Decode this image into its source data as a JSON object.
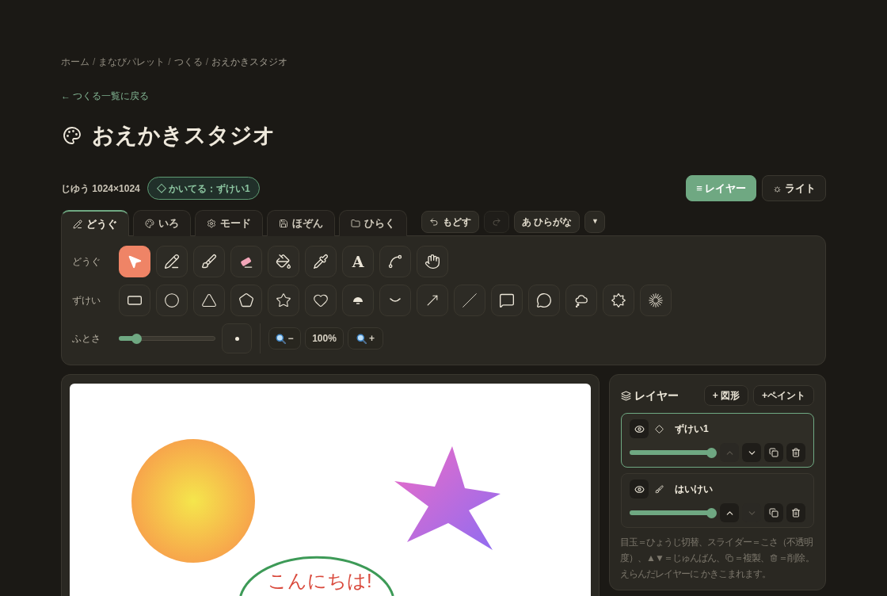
{
  "breadcrumb": [
    {
      "kind": "link",
      "text": "ホーム"
    },
    {
      "kind": "separator",
      "text": "/"
    },
    {
      "kind": "link",
      "text": "まなびパレット"
    },
    {
      "kind": "separator",
      "text": "/"
    },
    {
      "kind": "link",
      "text": "つくる"
    },
    {
      "kind": "separator",
      "text": "/"
    },
    {
      "kind": "current",
      "text": "おえかきスタジオ"
    }
  ],
  "back_link": "← つくる一覧に戻る",
  "title": "おえかきスタジオ",
  "canvas_info": "じゆう 1024×1024",
  "status_pill": "◇ かいてる：ずけい1",
  "header_buttons": [
    {
      "label": "≡ レイヤー",
      "on": true
    },
    {
      "label": "☼ ライト",
      "on": false
    }
  ],
  "tabs": [
    {
      "label": "どうぐ",
      "selected": true
    },
    {
      "label": "いろ",
      "selected": false
    },
    {
      "label": "モード",
      "selected": false
    },
    {
      "label": "ほぞん",
      "selected": false
    },
    {
      "label": "ひらく",
      "selected": false
    }
  ],
  "history": [
    {
      "kind": "undo",
      "label": "もどす",
      "disabled": false
    },
    {
      "kind": "redo",
      "disabled": true
    }
  ],
  "input_mode": {
    "label": "あ ひらがな",
    "menu": "▼"
  },
  "tools": {
    "label": "どうぐ",
    "items": [
      {
        "selected": true
      },
      {
        "selected": false
      },
      {
        "selected": false
      },
      {
        "selected": false
      },
      {
        "selected": false
      },
      {
        "selected": false
      },
      {
        "selected": false,
        "glyph": "A"
      },
      {
        "selected": false
      },
      {
        "selected": false
      }
    ]
  },
  "shapes": {
    "label": "ずけい",
    "items": [
      {
        "selected": false
      },
      {
        "selected": false
      },
      {
        "selected": false
      },
      {
        "selected": false
      },
      {
        "selected": false
      },
      {
        "selected": false
      },
      {
        "selected": false
      },
      {
        "selected": false
      },
      {
        "selected": false
      },
      {
        "selected": false
      },
      {
        "selected": false
      },
      {
        "selected": false
      },
      {
        "selected": false
      },
      {
        "selected": false
      },
      {
        "selected": false
      }
    ]
  },
  "stroke": {
    "label": "ふとさ",
    "level": 0.15
  },
  "zoom": {
    "out": "−",
    "reading": "100%",
    "in": "+"
  },
  "canvas": {
    "greeting": "こんにちは!"
  },
  "layers_panel": {
    "title": "レイヤー",
    "add_buttons": [
      "+ 図形",
      "+ペイント"
    ],
    "layers": [
      {
        "name": "ずけい1",
        "kind": "shape",
        "selected": true,
        "visible": true,
        "level": 1,
        "up_disabled": true,
        "down_disabled": false
      },
      {
        "name": "はいけい",
        "kind": "paint",
        "selected": false,
        "visible": true,
        "level": 1,
        "up_disabled": false,
        "down_disabled": true
      }
    ],
    "help_lines": [
      [
        "目玉＝ひょうじ切替、スライダー＝こさ（不透明"
      ],
      [
        "度）、▲▼＝じゅんばん、",
        "＝複製、",
        "＝削除。"
      ],
      [
        "えらんだレイヤーに かきこまれます。"
      ]
    ]
  }
}
